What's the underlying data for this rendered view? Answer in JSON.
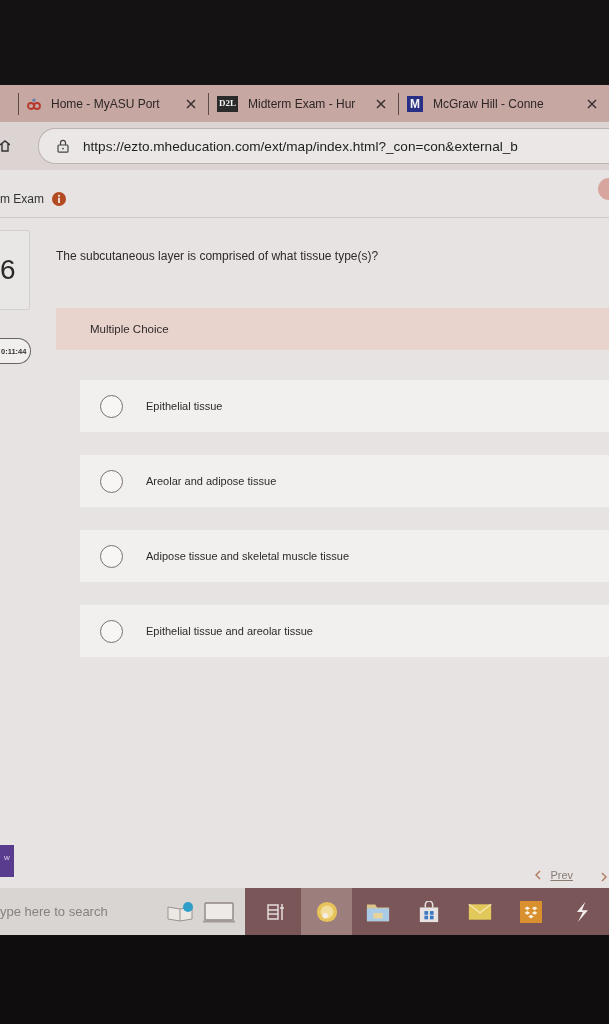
{
  "browser": {
    "tabs": [
      {
        "title": "Home - MyASU Port",
        "icon": {
          "kind": "rings"
        }
      },
      {
        "title": "Midterm Exam - Hur",
        "icon": {
          "kind": "letters",
          "text": "D2L",
          "color": "#2b2a2a"
        }
      },
      {
        "title": "McGraw Hill - Conne",
        "icon": {
          "kind": "letters",
          "text": "M",
          "color": "#2a2f86"
        }
      }
    ],
    "url": "https://ezto.mheducation.com/ext/map/index.html?_con=con&external_b"
  },
  "header": {
    "title": "m Exam"
  },
  "question": {
    "number": "6",
    "timer": "0:11:44",
    "text": "The subcutaneous layer is comprised of what tissue type(s)?",
    "type": "Multiple Choice",
    "options": [
      {
        "label": "Epithelial tissue",
        "selected": false
      },
      {
        "label": "Areolar and adipose tissue",
        "selected": false
      },
      {
        "label": "Adipose tissue and skeletal muscle tissue",
        "selected": false
      },
      {
        "label": "Epithelial tissue and areolar tissue",
        "selected": false
      }
    ]
  },
  "footer": {
    "side_tab": "w",
    "prev": "Prev"
  },
  "taskbar": {
    "placeholder": "ype here to search",
    "apps": [
      {
        "kind": "task-view",
        "selected": false
      },
      {
        "kind": "disc",
        "selected": true
      },
      {
        "kind": "folder",
        "selected": false
      },
      {
        "kind": "bag",
        "selected": false
      },
      {
        "kind": "mail",
        "selected": false
      },
      {
        "kind": "tile",
        "selected": false
      },
      {
        "kind": "bolt",
        "selected": false
      }
    ]
  }
}
